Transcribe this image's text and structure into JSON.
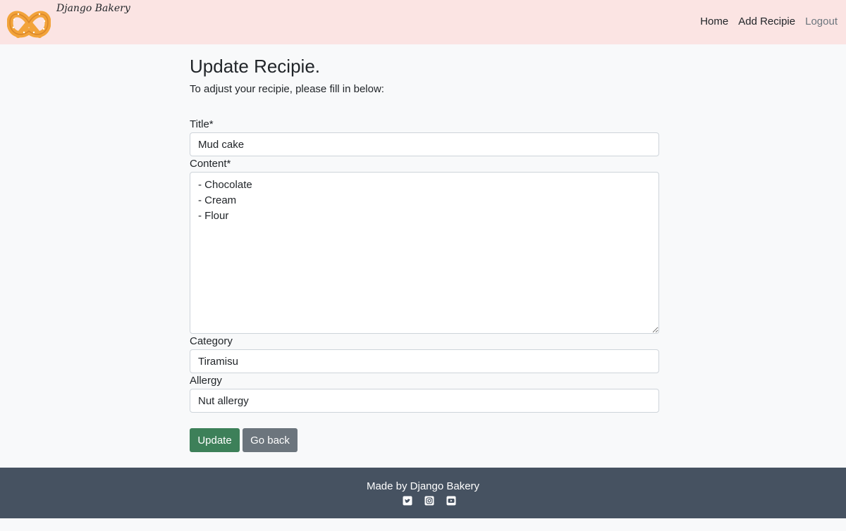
{
  "brand": {
    "name": "Django Bakery"
  },
  "nav": {
    "home": "Home",
    "add_recipe": "Add Recipie",
    "logout": "Logout"
  },
  "page": {
    "title": "Update Recipie.",
    "intro": "To adjust your recipie, please fill in below:"
  },
  "form": {
    "title_label": "Title*",
    "title_value": "Mud cake",
    "content_label": "Content*",
    "content_value": "- Chocolate\n- Cream\n- Flour",
    "category_label": "Category",
    "category_value": "Tiramisu",
    "allergy_label": "Allergy",
    "allergy_value": "Nut allergy",
    "update_button": "Update",
    "back_button": "Go back"
  },
  "footer": {
    "text": "Made by Django Bakery",
    "icons": [
      "twitter-icon",
      "instagram-icon",
      "youtube-icon"
    ]
  },
  "colors": {
    "navbar_bg": "#fbe4e3",
    "update_button": "#3d8059",
    "back_button": "#6c757d",
    "footer_bg": "#465261"
  }
}
